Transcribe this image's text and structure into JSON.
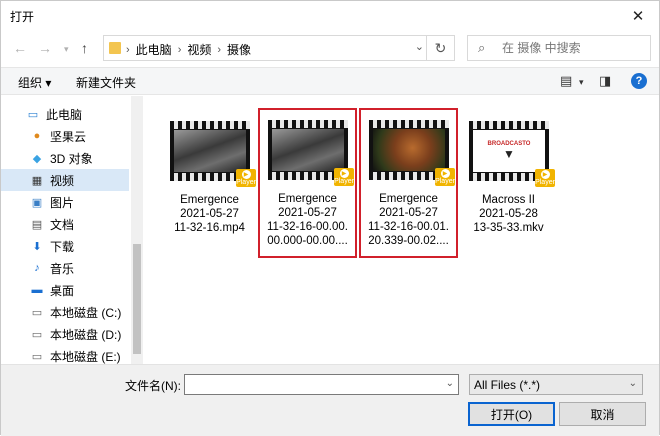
{
  "window": {
    "title": "打开"
  },
  "nav": {
    "crumbs": [
      "此电脑",
      "视频",
      "摄像"
    ],
    "search_placeholder": "在 摄像 中搜索"
  },
  "toolbar": {
    "organize": "组织",
    "new_folder": "新建文件夹"
  },
  "sidebar": {
    "items": [
      {
        "label": "此电脑",
        "icon": "computer-icon"
      },
      {
        "label": "坚果云",
        "icon": "nutstore-icon"
      },
      {
        "label": "3D 对象",
        "icon": "3d-objects-icon"
      },
      {
        "label": "视频",
        "icon": "video-folder-icon",
        "selected": true
      },
      {
        "label": "图片",
        "icon": "pictures-icon"
      },
      {
        "label": "文档",
        "icon": "documents-icon"
      },
      {
        "label": "下载",
        "icon": "download-icon"
      },
      {
        "label": "音乐",
        "icon": "music-icon"
      },
      {
        "label": "桌面",
        "icon": "desktop-icon"
      },
      {
        "label": "本地磁盘 (C:)",
        "icon": "drive-icon"
      },
      {
        "label": "本地磁盘 (D:)",
        "icon": "drive-icon"
      },
      {
        "label": "本地磁盘 (E:)",
        "icon": "drive-icon"
      }
    ]
  },
  "files": [
    {
      "lines": [
        "Emergence",
        "2021-05-27",
        "11-32-16.mp4"
      ],
      "badge": "Player",
      "highlighted": false
    },
    {
      "lines": [
        "Emergence",
        "2021-05-27",
        "11-32-16-00.00.",
        "00.000-00.00...."
      ],
      "badge": "Player",
      "highlighted": true
    },
    {
      "lines": [
        "Emergence",
        "2021-05-27",
        "11-32-16-00.01.",
        "20.339-00.02...."
      ],
      "badge": "Player",
      "highlighted": true
    },
    {
      "lines": [
        "Macross II",
        "2021-05-28",
        "13-35-33.mkv"
      ],
      "badge": "Player",
      "highlighted": false,
      "thumb_text": "BROADCASTO"
    }
  ],
  "bottom": {
    "filename_label": "文件名(N):",
    "filename_value": "",
    "filter_value": "All Files (*.*)",
    "open_button": "打开(O)",
    "cancel_button": "取消"
  }
}
